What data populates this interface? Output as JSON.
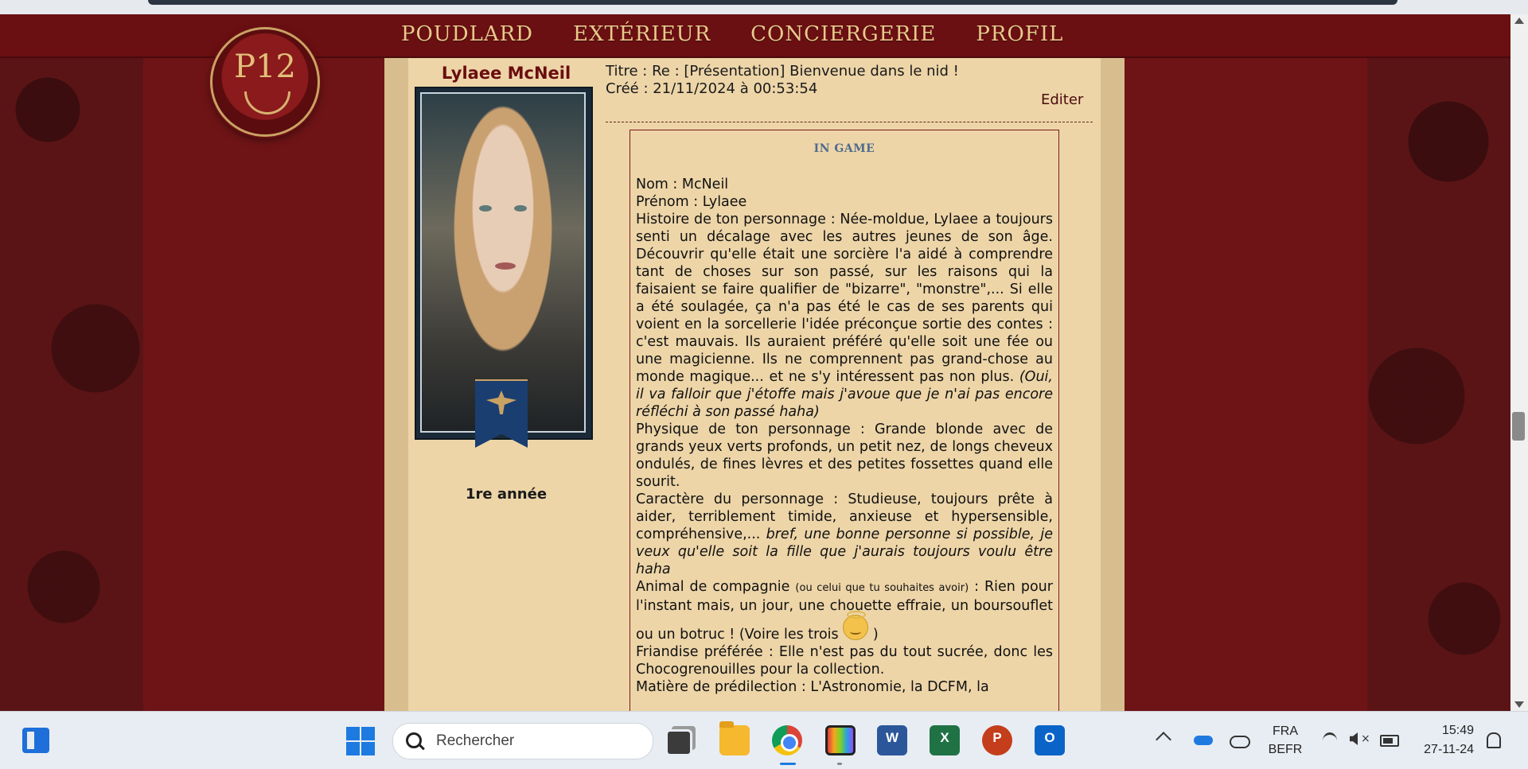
{
  "nav": {
    "items": [
      "POUDLARD",
      "EXTÉRIEUR",
      "CONCIERGERIE",
      "PROFIL"
    ]
  },
  "logo": {
    "text": "P12"
  },
  "author": {
    "name": "Lylaee McNeil",
    "rank": "1re année"
  },
  "post": {
    "title_line": "Titre : Re : [Présentation] Bienvenue dans le nid !",
    "created_line": "Créé : 21/11/2024 à 00:53:54",
    "edit_label": "Editer"
  },
  "rp": {
    "heading": "IN GAME",
    "nom": "Nom : McNeil",
    "prenom": "Prénom : Lylaee",
    "histoire": "Histoire de ton personnage : Née-moldue, Lylaee a toujours senti un décalage avec les autres jeunes de son âge. Découvrir qu'elle était une sorcière l'a aidé à comprendre tant de choses sur son passé, sur les raisons qui la faisaient se faire qualifier de \"bizarre\", \"monstre\",... Si elle a été soulagée, ça n'a pas été le cas de ses parents qui voient en la sorcellerie l'idée préconçue sortie des contes : c'est mauvais. Ils auraient préféré qu'elle soit une fée ou une magicienne. Ils ne comprennent pas grand-chose au monde magique... et ne s'y intéressent pas non plus.",
    "histoire_em": "(Oui, il va falloir que j'étoffe mais j'avoue que je n'ai pas encore réfléchi à son passé haha)",
    "physique": "Physique de ton personnage : Grande blonde avec de grands yeux verts profonds, un petit nez, de longs cheveux ondulés, de fines lèvres et des petites fossettes quand elle sourit.",
    "caractere": "Caractère du personnage : Studieuse, toujours prête à aider, terriblement timide, anxieuse et hypersensible, compréhensive,...",
    "caractere_em": "bref, une bonne personne si possible, je veux qu'elle soit la fille que j'aurais toujours voulu être haha",
    "animal_label": "Animal de compagnie",
    "animal_small": "(ou celui que tu souhaites avoir)",
    "animal_text": ": Rien pour l'instant mais, un jour, une chouette effraie, un boursouflet ou un botruc ! (Voire les trois",
    "animal_close": ")",
    "friandise": "Friandise préférée : Elle n'est pas du tout sucrée, donc les Chocogrenouilles pour la collection.",
    "matiere": "Matière de prédilection : L'Astronomie, la DCFM, la"
  },
  "taskbar": {
    "search_placeholder": "Rechercher",
    "lang_top": "FRA",
    "lang_bottom": "BEFR",
    "time": "15:49",
    "date": "27-11-24",
    "apps": [
      "task-view",
      "file-explorer",
      "chrome",
      "photos",
      "word",
      "excel",
      "powerpoint",
      "outlook"
    ],
    "word_letter": "W",
    "excel_letter": "X",
    "ppt_letter": "P",
    "outlook_letter": "O"
  },
  "colors": {
    "nav_bg": "#6a0f12",
    "nav_text": "#e9c98c",
    "parchment": "#edd5a8",
    "author_name": "#6a0d10",
    "rp_heading": "#4e6c8e"
  }
}
